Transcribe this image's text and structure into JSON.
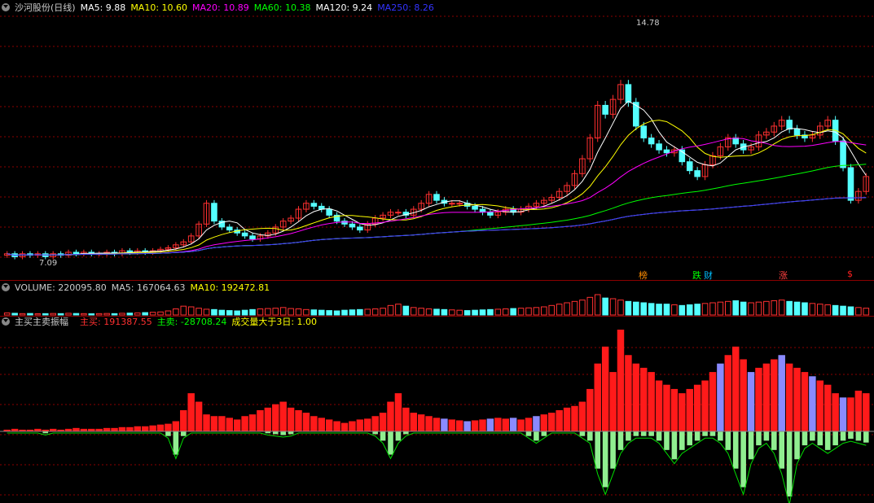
{
  "main": {
    "stock_title": "沙河股份(日线)",
    "ma": [
      {
        "label": "MA5: 9.88",
        "color": "#ffffff"
      },
      {
        "label": "MA10: 10.60",
        "color": "#ffff00"
      },
      {
        "label": "MA20: 10.89",
        "color": "#ff00ff"
      },
      {
        "label": "MA60: 10.38",
        "color": "#00ff00"
      },
      {
        "label": "MA120: 9.24",
        "color": "#ffffff"
      },
      {
        "label": "MA250: 8.26",
        "color": "#3333ff"
      }
    ],
    "high_label": "14.78",
    "low_label": "7.09",
    "tags": [
      {
        "text": "榜",
        "color": "#ff8c00"
      },
      {
        "text": "跌",
        "color": "#00ff00"
      },
      {
        "text": "财",
        "color": "#00bfff"
      },
      {
        "text": "涨",
        "color": "#ff4040"
      },
      {
        "text": "$",
        "color": "#ff2020"
      }
    ]
  },
  "volume": {
    "title": "VOLUME: 220095.80",
    "ma5": "MA5: 167064.63",
    "ma10": "MA10: 192472.81"
  },
  "indicator": {
    "title": "主买主卖振幅",
    "buy": "主买: 191387.55",
    "sell": "主卖: -28708.24",
    "cond": "成交量大于3日: 1.00"
  },
  "colors": {
    "up": "#ff3030",
    "down": "#54ffff",
    "bg": "#000000",
    "grid": "#8b0000",
    "buy_bar": "#ff1a1a",
    "alt_bar": "#8a8aff",
    "sell_bar": "#90ee90"
  },
  "chart_data": {
    "type": "candlestick",
    "closes": [
      7.3,
      7.2,
      7.3,
      7.25,
      7.3,
      7.2,
      7.3,
      7.25,
      7.35,
      7.3,
      7.35,
      7.3,
      7.3,
      7.35,
      7.3,
      7.4,
      7.35,
      7.4,
      7.35,
      7.4,
      7.45,
      7.5,
      7.6,
      7.7,
      7.9,
      8.3,
      9.0,
      8.4,
      8.2,
      8.1,
      8.0,
      7.9,
      7.8,
      7.9,
      8.0,
      8.2,
      8.4,
      8.5,
      8.8,
      9.0,
      8.9,
      8.8,
      8.6,
      8.4,
      8.3,
      8.2,
      8.1,
      8.3,
      8.5,
      8.6,
      8.7,
      8.7,
      8.6,
      8.8,
      9.0,
      9.3,
      9.1,
      9.0,
      9.0,
      9.0,
      8.9,
      8.8,
      8.7,
      8.6,
      8.7,
      8.8,
      8.7,
      8.8,
      8.9,
      9.0,
      9.1,
      9.2,
      9.4,
      9.6,
      10.0,
      10.5,
      11.2,
      12.3,
      12.0,
      12.5,
      13.0,
      12.4,
      11.6,
      11.2,
      11.0,
      10.8,
      10.7,
      10.8,
      10.4,
      10.1,
      9.9,
      10.3,
      10.6,
      10.9,
      11.2,
      11.0,
      10.8,
      10.9,
      11.3,
      11.4,
      11.6,
      11.8,
      11.5,
      11.3,
      11.2,
      11.3,
      11.6,
      11.8,
      11.1,
      10.2,
      9.1,
      9.4,
      9.9
    ],
    "opens": [
      7.25,
      7.3,
      7.2,
      7.3,
      7.25,
      7.3,
      7.2,
      7.3,
      7.25,
      7.35,
      7.3,
      7.35,
      7.3,
      7.3,
      7.35,
      7.3,
      7.4,
      7.35,
      7.4,
      7.35,
      7.4,
      7.45,
      7.5,
      7.6,
      7.7,
      7.9,
      8.3,
      9.0,
      8.4,
      8.2,
      8.1,
      8.0,
      7.9,
      7.8,
      7.9,
      8.0,
      8.2,
      8.4,
      8.5,
      8.8,
      9.0,
      8.9,
      8.8,
      8.6,
      8.4,
      8.3,
      8.2,
      8.1,
      8.3,
      8.5,
      8.6,
      8.7,
      8.7,
      8.6,
      8.8,
      9.0,
      9.3,
      9.1,
      9.0,
      9.0,
      9.0,
      8.9,
      8.8,
      8.7,
      8.6,
      8.7,
      8.8,
      8.7,
      8.8,
      8.9,
      9.0,
      9.1,
      9.2,
      9.4,
      9.6,
      10.0,
      10.5,
      11.2,
      12.3,
      12.0,
      12.5,
      13.0,
      12.4,
      11.6,
      11.2,
      11.0,
      10.8,
      10.7,
      10.8,
      10.4,
      10.1,
      9.9,
      10.3,
      10.6,
      10.9,
      11.2,
      11.0,
      10.8,
      10.9,
      11.3,
      11.4,
      11.6,
      11.8,
      11.5,
      11.3,
      11.2,
      11.3,
      11.6,
      11.8,
      11.1,
      10.2,
      9.1,
      9.4
    ],
    "ylim": [
      6.8,
      15.3
    ],
    "volume": [
      30,
      25,
      20,
      22,
      18,
      20,
      22,
      20,
      25,
      22,
      20,
      18,
      20,
      22,
      20,
      25,
      28,
      30,
      35,
      40,
      45,
      60,
      90,
      130,
      120,
      100,
      85,
      80,
      70,
      65,
      60,
      70,
      80,
      90,
      95,
      100,
      110,
      95,
      90,
      80,
      75,
      70,
      65,
      60,
      70,
      75,
      80,
      85,
      90,
      100,
      140,
      160,
      130,
      110,
      100,
      90,
      85,
      80,
      75,
      70,
      65,
      70,
      75,
      80,
      85,
      90,
      95,
      100,
      105,
      110,
      120,
      140,
      160,
      180,
      200,
      220,
      260,
      300,
      250,
      240,
      220,
      200,
      190,
      180,
      170,
      160,
      160,
      150,
      140,
      150,
      160,
      170,
      180,
      190,
      200,
      210,
      190,
      180,
      190,
      200,
      210,
      220,
      200,
      190,
      180,
      170,
      160,
      150,
      140,
      130,
      120,
      110,
      100
    ],
    "buy": [
      2,
      3,
      2,
      2,
      3,
      2,
      3,
      2,
      3,
      4,
      3,
      3,
      3,
      4,
      4,
      5,
      5,
      6,
      6,
      7,
      8,
      9,
      12,
      25,
      45,
      35,
      20,
      18,
      18,
      16,
      14,
      18,
      20,
      25,
      28,
      32,
      35,
      28,
      25,
      22,
      18,
      16,
      14,
      12,
      10,
      12,
      14,
      15,
      18,
      22,
      35,
      45,
      28,
      22,
      20,
      18,
      16,
      15,
      14,
      13,
      12,
      13,
      14,
      15,
      16,
      15,
      16,
      14,
      16,
      18,
      20,
      22,
      25,
      28,
      30,
      35,
      50,
      80,
      100,
      70,
      120,
      90,
      80,
      75,
      70,
      60,
      55,
      50,
      45,
      50,
      55,
      60,
      70,
      80,
      90,
      100,
      85,
      70,
      75,
      80,
      85,
      90,
      80,
      75,
      70,
      65,
      60,
      55,
      45,
      40,
      40,
      48,
      45
    ],
    "sell": [
      0,
      0,
      0,
      0,
      0,
      -2,
      0,
      0,
      0,
      0,
      0,
      0,
      0,
      0,
      0,
      0,
      0,
      0,
      0,
      0,
      0,
      -5,
      -25,
      -5,
      0,
      0,
      0,
      0,
      0,
      0,
      0,
      0,
      0,
      0,
      -2,
      -3,
      -4,
      -3,
      0,
      0,
      0,
      0,
      0,
      0,
      0,
      0,
      0,
      0,
      -3,
      -10,
      -25,
      -10,
      -3,
      0,
      0,
      0,
      0,
      0,
      0,
      0,
      0,
      0,
      0,
      0,
      0,
      0,
      0,
      0,
      -5,
      -10,
      -5,
      0,
      0,
      0,
      0,
      -5,
      -10,
      -40,
      -60,
      -40,
      -20,
      -10,
      -5,
      -5,
      -5,
      -10,
      -20,
      -30,
      -20,
      -15,
      -10,
      -5,
      -5,
      -10,
      -20,
      -40,
      -60,
      -30,
      -15,
      -10,
      -20,
      -40,
      -70,
      -30,
      -15,
      -10,
      -15,
      -20,
      -15,
      -10,
      -8,
      -10,
      -12
    ]
  }
}
